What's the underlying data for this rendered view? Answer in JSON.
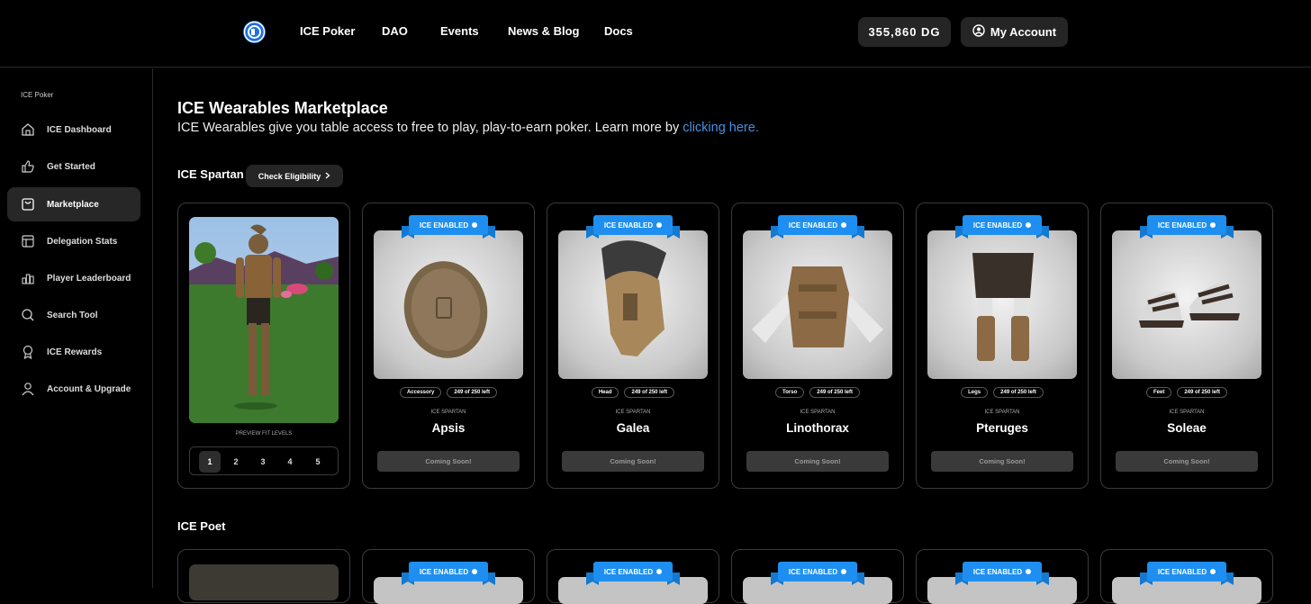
{
  "nav": {
    "links": [
      "ICE Poker",
      "DAO",
      "Events",
      "News & Blog",
      "Docs"
    ],
    "balance": "355,860 DG",
    "account_label": "My Account"
  },
  "sidebar": {
    "heading": "ICE Poker",
    "items": [
      {
        "label": "ICE Dashboard",
        "icon": "home-icon"
      },
      {
        "label": "Get Started",
        "icon": "thumbs-up-icon"
      },
      {
        "label": "Marketplace",
        "icon": "bag-icon",
        "active": true
      },
      {
        "label": "Delegation Stats",
        "icon": "layout-icon"
      },
      {
        "label": "Player Leaderboard",
        "icon": "bar-chart-icon"
      },
      {
        "label": "Search Tool",
        "icon": "search-icon"
      },
      {
        "label": "ICE Rewards",
        "icon": "award-icon"
      },
      {
        "label": "Account & Upgrade",
        "icon": "user-icon"
      }
    ]
  },
  "main": {
    "title": "ICE Wearables Marketplace",
    "subtitle_text": "ICE Wearables give you table access to free to play, play-to-earn poker. Learn more by ",
    "subtitle_link": "clicking here.",
    "check_eligibility": "Check Eligibility",
    "sections": [
      {
        "name": "ICE Spartan",
        "preview_label": "PREVIEW FIT LEVELS",
        "levels": [
          "1",
          "2",
          "3",
          "4",
          "5"
        ],
        "active_level": 1,
        "items": [
          {
            "badge": "ICE ENABLED",
            "slot": "Accessory",
            "supply": "249 of 250 left",
            "collection": "ICE SPARTAN",
            "name": "Apsis",
            "action": "Coming Soon!"
          },
          {
            "badge": "ICE ENABLED",
            "slot": "Head",
            "supply": "249 of 250 left",
            "collection": "ICE SPARTAN",
            "name": "Galea",
            "action": "Coming Soon!"
          },
          {
            "badge": "ICE ENABLED",
            "slot": "Torso",
            "supply": "249 of 250 left",
            "collection": "ICE SPARTAN",
            "name": "Linothorax",
            "action": "Coming Soon!"
          },
          {
            "badge": "ICE ENABLED",
            "slot": "Legs",
            "supply": "249 of 250 left",
            "collection": "ICE SPARTAN",
            "name": "Pteruges",
            "action": "Coming Soon!"
          },
          {
            "badge": "ICE ENABLED",
            "slot": "Feet",
            "supply": "249 of 250 left",
            "collection": "ICE SPARTAN",
            "name": "Soleae",
            "action": "Coming Soon!"
          }
        ]
      },
      {
        "name": "ICE Poet",
        "items": [
          {
            "badge": "ICE ENABLED"
          },
          {
            "badge": "ICE ENABLED"
          },
          {
            "badge": "ICE ENABLED"
          },
          {
            "badge": "ICE ENABLED"
          },
          {
            "badge": "ICE ENABLED"
          }
        ]
      }
    ]
  },
  "colors": {
    "background": "#000000",
    "accent_blue": "#1e8ff0",
    "link_blue": "#4a90e2",
    "panel": "#252525"
  }
}
